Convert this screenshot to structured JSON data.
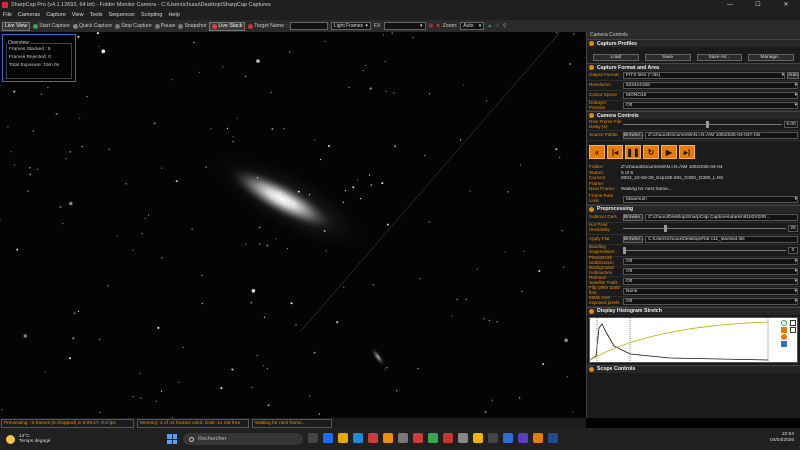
{
  "window": {
    "title": "SharpCap Pro (v4.1.12693, 64 bit) - Folder Monitor Camera - C:\\Users\\chuuu\\Desktop\\SharpCap Captures",
    "controls": [
      "—",
      "☐",
      "✕"
    ]
  },
  "menu": [
    "File",
    "Cameras",
    "Capture",
    "View",
    "Tools",
    "Sequencer",
    "Scripting",
    "Help"
  ],
  "toolbar": {
    "live_view": "Live View",
    "start_capture": "Start Capture",
    "quick_capture": "Quick Capture",
    "stop_capture": "Stop Capture",
    "pause": "Pause",
    "snapshot": "Snapshot",
    "live_stack": "Live Stack",
    "target_name": "Target Name :",
    "frame_type": "Light Frames",
    "fx": "FX",
    "zoom_label": "Zoom:",
    "zoom_value": "Auto"
  },
  "overview": {
    "title": "Overview",
    "frames_stacked": "Frames Stacked : 5",
    "frames_rejected": "Frames Rejected: 0",
    "total_exposure": "Total Exposure:     15m 0s"
  },
  "panel": {
    "header": "Camera Controls",
    "capture_profiles": {
      "title": "Capture Profiles",
      "buttons": [
        "Load",
        "Save",
        "Save As...",
        "Manage..."
      ]
    },
    "capture_format": {
      "title": "Capture Format and Area",
      "output_format_label": "Output Format",
      "output_format": "FITS files (*.fits)",
      "auto": "Auto",
      "resolution_label": "Resolution",
      "resolution": "6224x4168",
      "colour_space_label": "Colour Space",
      "colour_space": "MONO16",
      "debayer_label": "Debayer Preview",
      "debayer": "Off"
    },
    "camera_controls": {
      "title": "Camera Controls",
      "new_frame_label": "New Frame File Delay (s)",
      "new_frame_value": "5.00",
      "source_folder_label": "Source Folder",
      "browse": "Browse...",
      "source_folder": "Z:\\chuuu\\Documents\\N.I.N.A\\M 106\\2026-04-04\\*.fits",
      "folder_label": "Folder:",
      "folder": "Z:\\chuuu\\Documents\\N.I.N.A\\M 106\\2026-04-04",
      "status_label": "Status:",
      "status": "5 of 5",
      "current_frame_label": "Current Frame:",
      "current_frame": "0004_22-50-29_Exp180.00s_G300_O300_L.fits",
      "next_frame_label": "Next Frame:",
      "next_frame": "Waiting for next frame...",
      "frame_rate_label": "Frame Rate Limit",
      "frame_rate": "Maximum"
    },
    "preprocessing": {
      "title": "Preprocessing",
      "subtract_dark_label": "Subtract Dark",
      "browse": "Browse...",
      "subtract_dark": "Z:\\chuuu\\Desktop\\SharpCap Captures\\darks\\6192X00R...",
      "hot_pixel_label": "Hot Pixel Sensitivity",
      "hot_pixel_value": "25",
      "apply_flat_label": "Apply Flat",
      "apply_flat": "C:\\Users\\chuuu\\Desktop\\Flat c11_stacked.fits",
      "banding_label": "Banding Suppression",
      "banding_value": "0",
      "planet_label": "Planet/Disk Stabilization",
      "planet": "Off",
      "background_label": "Background Subtraction",
      "background": "Off",
      "satellite_label": "Remove Satellite Trails",
      "satellite": "Off",
      "flip_label": "Flip (after dark/ flat)",
      "flip": "None",
      "mask_label": "Mask over exposed pixels",
      "mask": "Off"
    },
    "histogram": {
      "title": "Display Histogram Stretch"
    },
    "scope": {
      "title": "Scope Controls"
    }
  },
  "statusbar": {
    "previewing": "Previewing : 6 frames (0 dropped) in 9:08:17, 0.0 fps",
    "memory": "Memory: 4 of 41 frames used, Disk: 44 GB free",
    "waiting": "Waiting for next frame..."
  },
  "taskbar": {
    "temperature": "14°C",
    "weather": "Temps dégagé",
    "search": "Rechercher",
    "time": "22:53",
    "date": "04/04/2026"
  },
  "colors": {
    "accent": "#f28c00",
    "overview_border": "#2d6fd6"
  }
}
